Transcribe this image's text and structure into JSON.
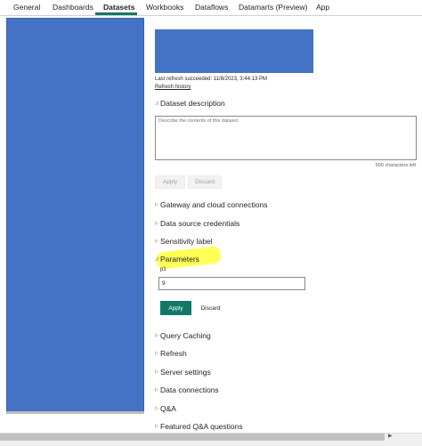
{
  "tabs": [
    {
      "label": "General"
    },
    {
      "label": "Dashboards"
    },
    {
      "label": "Datasets"
    },
    {
      "label": "Workbooks"
    },
    {
      "label": "Dataflows"
    },
    {
      "label": "Datamarts (Preview)"
    },
    {
      "label": "App"
    }
  ],
  "active_tab": "Datasets",
  "dataset": {
    "last_refresh": "Last refresh succeeded: 11/8/2023, 3:44:13 PM",
    "refresh_history_label": "Refresh history"
  },
  "description": {
    "title": "Dataset description",
    "placeholder": "Describe the contents of this dataset.",
    "chars_left": "500 characters left",
    "apply_label": "Apply",
    "discard_label": "Discard"
  },
  "sections_top": [
    {
      "label": "Gateway and cloud connections"
    },
    {
      "label": "Data source credentials"
    },
    {
      "label": "Sensitivity label"
    }
  ],
  "parameters": {
    "title": "Parameters",
    "param_name": "p1",
    "param_value": "9",
    "apply_label": "Apply",
    "discard_label": "Discard"
  },
  "sections_bottom": [
    {
      "label": "Query Caching"
    },
    {
      "label": "Refresh"
    },
    {
      "label": "Server settings"
    },
    {
      "label": "Data connections"
    },
    {
      "label": "Q&A"
    },
    {
      "label": "Featured Q&A questions"
    }
  ],
  "icons": {
    "collapsed_chevron": "▷",
    "expanded_chevron": "◿",
    "scroll_arrow": "▶"
  },
  "colors": {
    "accent": "#117865",
    "placeholder_blue": "#4472c4",
    "highlight": "#ffff4d"
  }
}
